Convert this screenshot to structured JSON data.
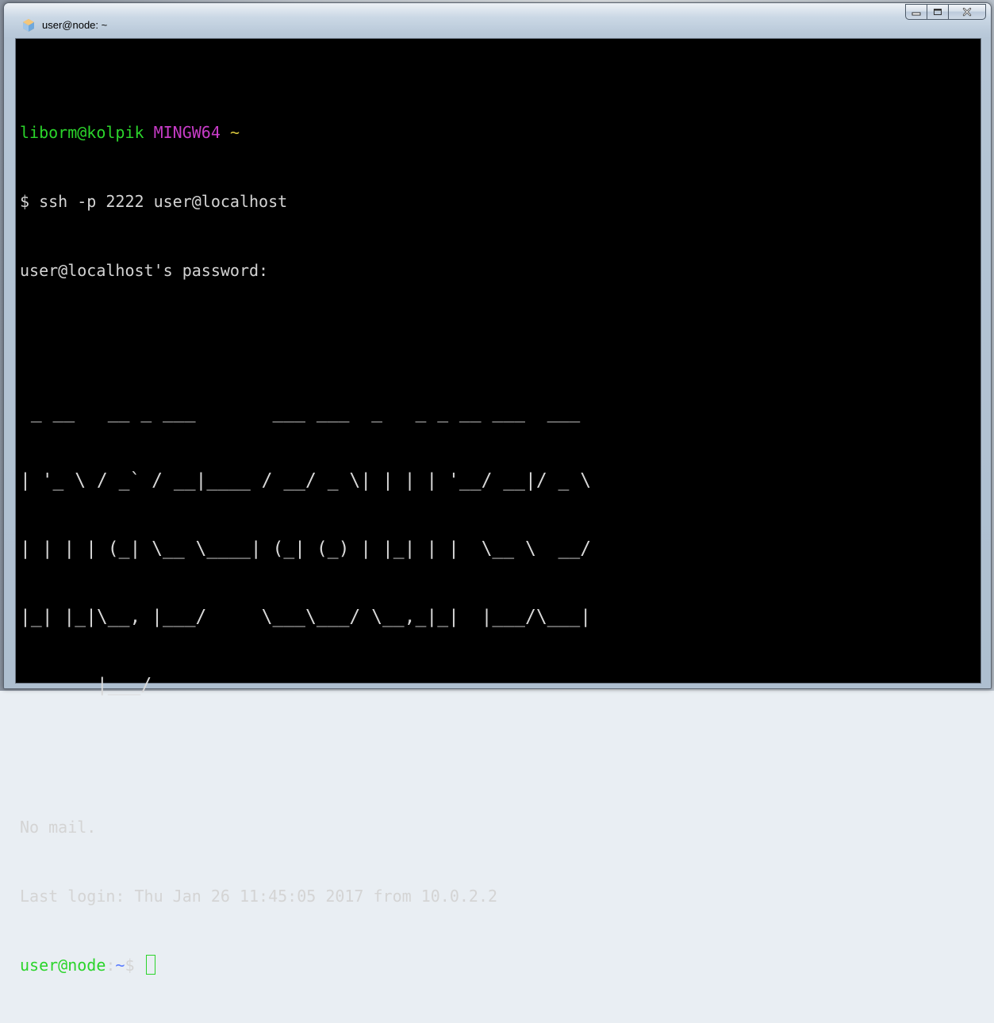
{
  "window": {
    "title": "user@node: ~"
  },
  "controls": {
    "minimize_icon": "minimize-icon",
    "maximize_icon": "maximize-icon",
    "close_icon": "close-icon"
  },
  "terminal": {
    "prompt1": {
      "user_host": "liborm@kolpik",
      "system": "MINGW64",
      "path": "~"
    },
    "command": "$ ssh -p 2222 user@localhost",
    "password_prompt": "user@localhost's password:",
    "ascii_art": [
      " _ __   __ _ ___       ___ ___  _   _ _ __ ___  ___ ",
      "| '_ \\ / _` / __|____ / __/ _ \\| | | | '__/ __|/ _ \\",
      "| | | | (_| \\__ \\____| (_| (_) | |_| | |  \\__ \\  __/",
      "|_| |_|\\__, |___/     \\___\\___/ \\__,_|_|  |___/\\___|",
      "       |___/                                        "
    ],
    "no_mail": "No mail.",
    "last_login": "Last login: Thu Jan 26 11:45:05 2017 from 10.0.2.2",
    "prompt2": {
      "user_host": "user@node",
      "separator": ":",
      "path": "~",
      "symbol": "$ "
    }
  },
  "colors": {
    "prompt_green": "#2bd42b",
    "mingw_magenta": "#c83cc8",
    "tilde_yellow": "#d6c43c",
    "path_blue": "#5a7cff",
    "background": "#000000",
    "text": "#d4d4d4"
  }
}
